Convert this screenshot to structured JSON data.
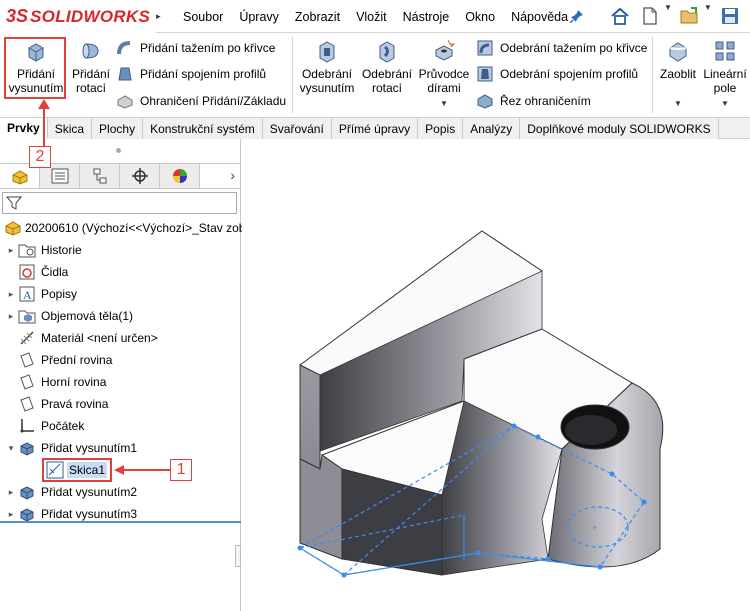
{
  "app": {
    "logo_ds": "3S",
    "logo_text": "SOLIDWORKS",
    "brand_color": "#d8262e"
  },
  "menubar": {
    "items": [
      "Soubor",
      "Úpravy",
      "Zobrazit",
      "Vložit",
      "Nástroje",
      "Okno",
      "Nápověda"
    ]
  },
  "quick_access": {
    "icons": [
      "home-icon",
      "new-document-icon",
      "open-folder-icon",
      "save-icon"
    ]
  },
  "ribbon": {
    "extrude_boss": [
      "Přidání",
      "vysunutím"
    ],
    "revolve_boss": [
      "Přidání",
      "rotací"
    ],
    "swept_boss": "Přidání tažením po křivce",
    "lofted_boss": "Přidání spojením profilů",
    "boundary_boss": "Ohraničení Přidání/Základu",
    "extruded_cut": [
      "Odebrání",
      "vysunutím"
    ],
    "revolved_cut": [
      "Odebrání",
      "rotací"
    ],
    "hole_wizard": [
      "Průvodce",
      "dírami"
    ],
    "swept_cut": "Odebrání tažením po křivce",
    "lofted_cut": "Odebrání spojením profilů",
    "boundary_cut": "Řez ohraničením",
    "fillet": "Zaoblit",
    "linear_pattern": [
      "Lineární",
      "pole"
    ]
  },
  "tabs": [
    "Prvky",
    "Skica",
    "Plochy",
    "Konstrukční systém",
    "Svařování",
    "Přímé úpravy",
    "Popis",
    "Analýzy",
    "Doplňkové moduly SOLIDWORKS"
  ],
  "tree": {
    "root": "20200610  (Výchozí<<Výchozí>_Stav zob",
    "items": [
      {
        "label": "Historie",
        "expander": "▸"
      },
      {
        "label": "Čidla",
        "expander": ""
      },
      {
        "label": "Popisy",
        "expander": "▸"
      },
      {
        "label": "Objemová těla(1)",
        "expander": "▸"
      },
      {
        "label": "Materiál <není určen>",
        "expander": ""
      },
      {
        "label": "Přední rovina",
        "expander": ""
      },
      {
        "label": "Horní rovina",
        "expander": ""
      },
      {
        "label": "Pravá rovina",
        "expander": ""
      },
      {
        "label": "Počátek",
        "expander": ""
      },
      {
        "label": "Přidat vysunutím1",
        "expander": "▾"
      },
      {
        "label": "Skica1",
        "expander": ""
      },
      {
        "label": "Přidat vysunutím2",
        "expander": "▸"
      },
      {
        "label": "Přidat vysunutím3",
        "expander": "▸"
      }
    ]
  },
  "callouts": {
    "one": "1",
    "two": "2",
    "color": "#e0403a"
  },
  "colors": {
    "selection_blue": "#4f8fcc",
    "sketch_line": "#3b8cf0"
  }
}
